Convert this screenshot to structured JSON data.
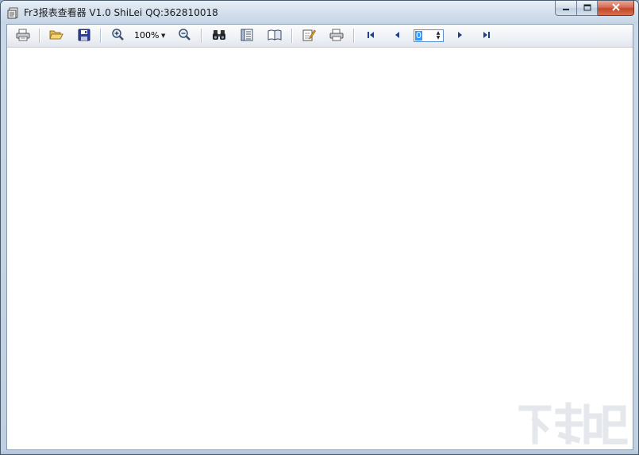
{
  "window": {
    "title": "Fr3报表查看器 V1.0 ShiLei QQ:362810018",
    "app_icon": "report-viewer-icon",
    "controls": [
      "minimize-icon",
      "maximize-icon",
      "close-icon"
    ]
  },
  "toolbar": {
    "buttons": [
      {
        "name": "print",
        "icon": "printer-icon"
      },
      {
        "name": "open",
        "icon": "folder-open-icon"
      },
      {
        "name": "save",
        "icon": "floppy-disk-icon"
      },
      {
        "name": "zoom-in",
        "icon": "zoom-in-icon"
      },
      {
        "name": "zoom-out",
        "icon": "zoom-out-icon"
      },
      {
        "name": "find",
        "icon": "binoculars-icon"
      },
      {
        "name": "outline",
        "icon": "outline-list-icon"
      },
      {
        "name": "page-setup",
        "icon": "book-icon"
      },
      {
        "name": "edit",
        "icon": "edit-page-icon"
      },
      {
        "name": "print-2",
        "icon": "printer-icon"
      },
      {
        "name": "first-page",
        "icon": "first-page-icon"
      },
      {
        "name": "prev-page",
        "icon": "prev-page-icon"
      },
      {
        "name": "next-page",
        "icon": "next-page-icon"
      },
      {
        "name": "last-page",
        "icon": "last-page-icon"
      }
    ],
    "zoom": {
      "value": "100%"
    },
    "page": {
      "value": "0"
    }
  },
  "colors": {
    "title_bar": "#d4e0ed",
    "close_button": "#c5452b",
    "nav_arrow": "#1f3f8f",
    "page_selection": "#3399ff"
  },
  "watermark": {
    "icon": "download-site-logo"
  }
}
